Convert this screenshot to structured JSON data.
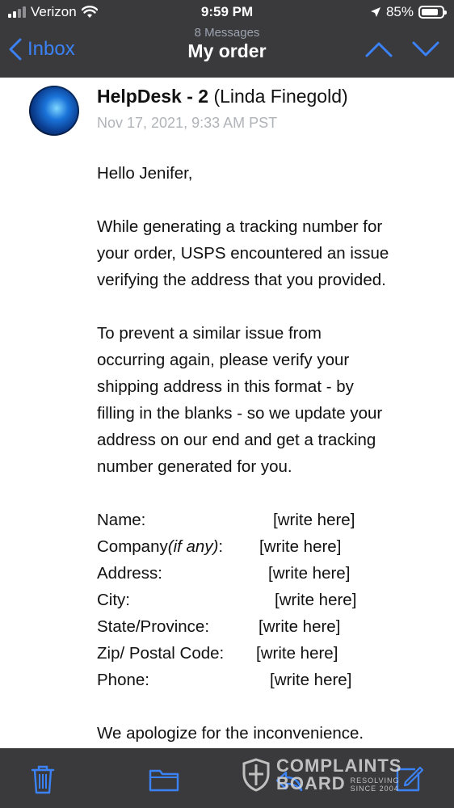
{
  "status_bar": {
    "carrier": "Verizon",
    "time": "9:59 PM",
    "battery": "85%",
    "battery_level": 0.85
  },
  "nav": {
    "back_label": "Inbox",
    "message_count": "8 Messages",
    "title": "My order"
  },
  "message": {
    "sender_name": "HelpDesk - 2",
    "sender_detail": "(Linda Finegold)",
    "date": "Nov 17, 2021, 9:33 AM PST",
    "greeting": "Hello Jenifer,",
    "para1": [
      "While generating a tracking number for",
      "your order, USPS encountered an issue",
      "verifying the address that you provided."
    ],
    "para2": [
      "To prevent a similar issue from",
      "occurring again, please verify your",
      "shipping address in this format - by",
      "filling in the blanks - so we update your",
      "address on our end and get a tracking",
      "number generated for you."
    ],
    "form": [
      {
        "label": "Name:",
        "value": "[write here]"
      },
      {
        "label": "Company",
        "label_italic": "(if any)",
        "label_suffix": ":",
        "value": "[write here]"
      },
      {
        "label": "Address:",
        "value": "[write here]"
      },
      {
        "label": "City:",
        "value": "[write here]"
      },
      {
        "label": "State/Province:",
        "value": "[write here]"
      },
      {
        "label": "Zip/ Postal Code:",
        "value": "[write here]"
      },
      {
        "label": "Phone:",
        "value": "[write here]"
      }
    ],
    "closing": "We apologize for the inconvenience."
  },
  "toolbar": {
    "icons": [
      "trash-icon",
      "folder-icon",
      "reply-icon",
      "compose-icon"
    ]
  },
  "watermark": {
    "line1": "COMPLAINTS",
    "line2": "BOARD",
    "tag1": "RESOLVING",
    "tag2": "SINCE 2004"
  },
  "colors": {
    "bar_background": "#3a3a3c",
    "accent": "#3b82f6"
  }
}
